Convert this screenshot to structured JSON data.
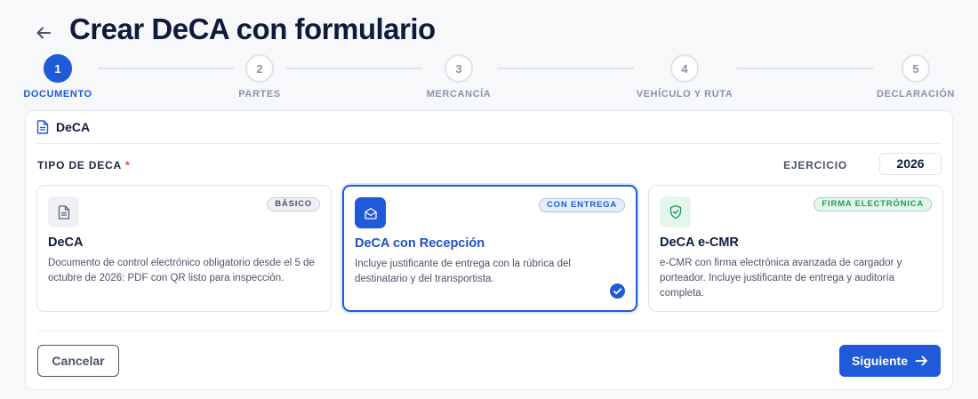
{
  "header": {
    "title": "Crear DeCA con formulario"
  },
  "stepper": {
    "steps": [
      {
        "number": "1",
        "label": "DOCUMENTO",
        "active": true
      },
      {
        "number": "2",
        "label": "PARTES",
        "active": false
      },
      {
        "number": "3",
        "label": "MERCANCÍA",
        "active": false
      },
      {
        "number": "4",
        "label": "VEHÍCULO Y RUTA",
        "active": false
      },
      {
        "number": "5",
        "label": "DECLARACIÓN",
        "active": false
      }
    ]
  },
  "card": {
    "title": "DeCA",
    "type_label": "TIPO DE DECA",
    "required_mark": "*",
    "ejercicio_label": "EJERCICIO",
    "ejercicio_value": "2026",
    "options": [
      {
        "badge": "BÁSICO",
        "title": "DeCA",
        "description": "Documento de control electrónico obligatorio desde el 5 de octubre de 2026: PDF con QR listo para inspección.",
        "icon": "document-icon",
        "selected": false
      },
      {
        "badge": "CON ENTREGA",
        "title": "DeCA con Recepción",
        "description": "Incluye justificante de entrega con la rúbrica del destinatario y del transportista.",
        "icon": "envelope-open-icon",
        "selected": true
      },
      {
        "badge": "FIRMA ELECTRÓNICA",
        "title": "DeCA e-CMR",
        "description": "e-CMR con firma electrónica avanzada de cargador y porteador. Incluye justificante de entrega y auditoría completa.",
        "icon": "shield-check-icon",
        "selected": false
      }
    ]
  },
  "footer": {
    "cancel_label": "Cancelar",
    "next_label": "Siguiente"
  },
  "colors": {
    "accent": "#1f5ad9",
    "title": "#0f1b3d",
    "muted": "#8a93a6",
    "success": "#1e9e57"
  }
}
